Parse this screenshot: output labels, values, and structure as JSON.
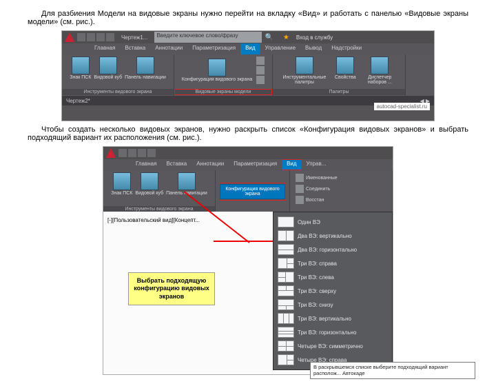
{
  "para1": "Для разбиения Модели на видовые экраны нужно перейти на вкладку «Вид» и работать с панелью «Видовые экраны модели» (см. рис.).",
  "para2": "Чтобы создать несколько видовых экранов, нужно раскрыть список «Конфигурация видовых экранов» и выбрать подходящий вариант их расположения (см. рис.).",
  "fig1": {
    "title": "Чертеж1...",
    "search_placeholder": "Введите ключевое слово/фразу",
    "login": "Вход в службу",
    "tabs": [
      "Главная",
      "Вставка",
      "Аннотации",
      "Параметризация",
      "Вид",
      "Управление",
      "Вывод",
      "Надстройки"
    ],
    "active_tab": 4,
    "panel1": {
      "btns": [
        "Знак ПСК",
        "Видовой куб",
        "Панель навигации"
      ],
      "name": "Инструменты видового экрана"
    },
    "panel2": {
      "btn": "Конфигурация видового экрана",
      "name": "Видовые экраны модели"
    },
    "panel3": {
      "btns": [
        "Инструментальные палитры",
        "Свойства",
        "Диспетчер наборов ..."
      ],
      "name": "Палитры"
    },
    "status_left": "Чертеж2*",
    "watermark": "autocad-specialist.ru"
  },
  "fig2": {
    "tabs": [
      "Главная",
      "Вставка",
      "Аннотации",
      "Параметризация",
      "Вид",
      "Управ..."
    ],
    "active_tab": 4,
    "panel1": {
      "btns": [
        "Знак ПСК",
        "Видовой куб",
        "Панель навигации"
      ],
      "name": "Инструменты видового экрана"
    },
    "conf_btn": "Конфигурация видового экрана",
    "side_items": [
      "Именованные",
      "Соединить",
      "Восстан"
    ],
    "viewport_label": "[-][Пользовательский вид][Концепт...",
    "callout": "Выбрать подходящую конфигурацию видовых экранов",
    "dropdown": [
      "Один ВЭ",
      "Два ВЭ: вертикально",
      "Два ВЭ: горизонтально",
      "Три ВЭ: справа",
      "Три ВЭ: слева",
      "Три ВЭ: сверху",
      "Три ВЭ: снизу",
      "Три ВЭ: вертикально",
      "Три ВЭ: горизонтально",
      "Четыре ВЭ: симметрично",
      "Четыре ВЭ: справа"
    ],
    "dd_icons": [
      "",
      "dd-v",
      "dd-h",
      "dd-3r",
      "dd-3l",
      "dd-3t",
      "dd-3b",
      "dd-3v",
      "dd-3hz",
      "dd-4",
      "dd-3r"
    ],
    "tooltip": "В раскрывшемся списке выберите подходящий вариант располож... Автокаде"
  }
}
